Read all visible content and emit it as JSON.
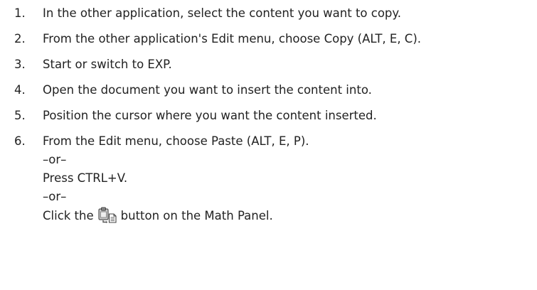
{
  "steps": [
    {
      "number": "1.",
      "text": "In the other application, select the content you want to copy."
    },
    {
      "number": "2.",
      "text": "From the other application's Edit menu, choose Copy (ALT, E, C)."
    },
    {
      "number": "3.",
      "text": "Start or switch to EXP."
    },
    {
      "number": "4.",
      "text": "Open the document you want to insert the content into."
    },
    {
      "number": "5.",
      "text": "Position the cursor where you want the content inserted."
    },
    {
      "number": "6.",
      "lines": {
        "paste_menu": "From the Edit menu, choose Paste (ALT, E, P).",
        "or_1": "–or–",
        "shortcut": "Press CTRL+V.",
        "or_2": "–or–",
        "click_prefix": "Click the",
        "click_suffix": "button on the Math Panel."
      },
      "icon": "paste-icon"
    }
  ]
}
